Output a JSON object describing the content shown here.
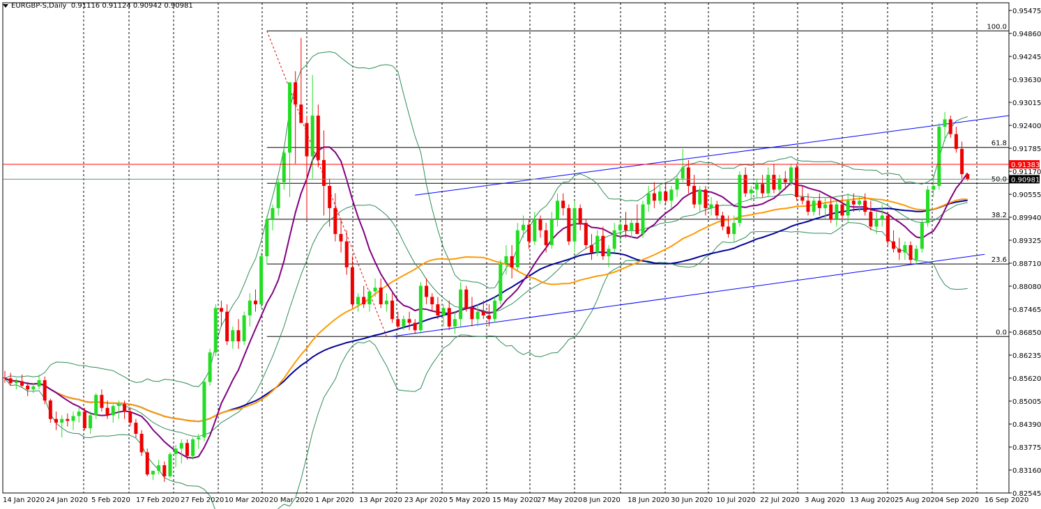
{
  "header": {
    "symbol": "EURGBP-S,Daily",
    "ohlc": "0.91116 0.91124 0.90942 0.90981"
  },
  "price_axis": {
    "ticks": [
      "0.95475",
      "0.94860",
      "0.94245",
      "0.93630",
      "0.93015",
      "0.92400",
      "0.91785",
      "0.91170",
      "0.90555",
      "0.89940",
      "0.89325",
      "0.88710",
      "0.88080",
      "0.87465",
      "0.86850",
      "0.86235",
      "0.85620",
      "0.85005",
      "0.84390",
      "0.83775",
      "0.83160",
      "0.82545"
    ],
    "current_price_label": "0.90981",
    "red_line_label": "0.91383"
  },
  "date_axis": {
    "labels": [
      "14 Jan 2020",
      "24 Jan 2020",
      "5 Feb 2020",
      "17 Feb 2020",
      "27 Feb 2020",
      "10 Mar 2020",
      "20 Mar 2020",
      "1 Apr 2020",
      "13 Apr 2020",
      "23 Apr 2020",
      "5 May 2020",
      "15 May 2020",
      "27 May 2020",
      "8 Jun 2020",
      "18 Jun 2020",
      "30 Jun 2020",
      "10 Jul 2020",
      "22 Jul 2020",
      "3 Aug 2020",
      "13 Aug 2020",
      "25 Aug 2020",
      "4 Sep 2020",
      "16 Sep 2020"
    ]
  },
  "fib_levels": [
    {
      "label": "100.0",
      "value": 0.9499
    },
    {
      "label": "61.8",
      "value": 0.9184
    },
    {
      "label": "50.0",
      "value": 0.9087
    },
    {
      "label": "38.2",
      "value": 0.899
    },
    {
      "label": "23.6",
      "value": 0.8869
    },
    {
      "label": "0.0",
      "value": 0.8673
    }
  ],
  "colors": {
    "bull": "#22dd22",
    "bear": "#ee0000",
    "ma_fast": "#800080",
    "ma_mid": "#ff9900",
    "ma_slow": "#000099",
    "bands": "#2e8b57",
    "trend": "#0000ff",
    "red_line": "#ff0000",
    "grey_line": "#6b8e6b"
  },
  "chart_data": {
    "type": "candlestick",
    "symbol": "EURGBP-S",
    "timeframe": "Daily",
    "ylim": [
      0.825,
      0.9575
    ],
    "candles": [
      [
        0.8562,
        0.858,
        0.8548,
        0.856
      ],
      [
        0.856,
        0.8575,
        0.854,
        0.8547
      ],
      [
        0.8547,
        0.856,
        0.853,
        0.8552
      ],
      [
        0.8552,
        0.857,
        0.8535,
        0.854
      ],
      [
        0.854,
        0.855,
        0.8512,
        0.853
      ],
      [
        0.853,
        0.8545,
        0.852,
        0.8538
      ],
      [
        0.8538,
        0.857,
        0.853,
        0.8555
      ],
      [
        0.8555,
        0.8565,
        0.849,
        0.85
      ],
      [
        0.85,
        0.8505,
        0.844,
        0.845
      ],
      [
        0.845,
        0.847,
        0.842,
        0.844
      ],
      [
        0.844,
        0.846,
        0.84,
        0.845
      ],
      [
        0.845,
        0.8465,
        0.843,
        0.8445
      ],
      [
        0.8445,
        0.847,
        0.842,
        0.8458
      ],
      [
        0.8458,
        0.848,
        0.844,
        0.847
      ],
      [
        0.847,
        0.848,
        0.842,
        0.8425
      ],
      [
        0.8425,
        0.847,
        0.841,
        0.846
      ],
      [
        0.846,
        0.852,
        0.845,
        0.8515
      ],
      [
        0.8515,
        0.853,
        0.847,
        0.848
      ],
      [
        0.848,
        0.85,
        0.845,
        0.846
      ],
      [
        0.846,
        0.849,
        0.844,
        0.8485
      ],
      [
        0.8485,
        0.85,
        0.845,
        0.849
      ],
      [
        0.849,
        0.85,
        0.845,
        0.847
      ],
      [
        0.847,
        0.848,
        0.843,
        0.844
      ],
      [
        0.844,
        0.845,
        0.84,
        0.841
      ],
      [
        0.841,
        0.842,
        0.835,
        0.836
      ],
      [
        0.836,
        0.837,
        0.8295,
        0.83
      ],
      [
        0.83,
        0.831,
        0.8285,
        0.831
      ],
      [
        0.831,
        0.834,
        0.83,
        0.8325
      ],
      [
        0.8325,
        0.8335,
        0.828,
        0.8295
      ],
      [
        0.8295,
        0.836,
        0.829,
        0.8355
      ],
      [
        0.8355,
        0.838,
        0.832,
        0.837
      ],
      [
        0.837,
        0.8395,
        0.833,
        0.8385
      ],
      [
        0.8385,
        0.8395,
        0.834,
        0.835
      ],
      [
        0.835,
        0.84,
        0.834,
        0.8395
      ],
      [
        0.8395,
        0.841,
        0.837,
        0.84
      ],
      [
        0.84,
        0.856,
        0.839,
        0.855
      ],
      [
        0.855,
        0.864,
        0.854,
        0.863
      ],
      [
        0.863,
        0.876,
        0.862,
        0.875
      ],
      [
        0.875,
        0.877,
        0.87,
        0.874
      ],
      [
        0.874,
        0.876,
        0.865,
        0.866
      ],
      [
        0.866,
        0.87,
        0.864,
        0.869
      ],
      [
        0.869,
        0.872,
        0.864,
        0.866
      ],
      [
        0.866,
        0.874,
        0.865,
        0.873
      ],
      [
        0.873,
        0.879,
        0.87,
        0.877
      ],
      [
        0.877,
        0.88,
        0.874,
        0.876
      ],
      [
        0.876,
        0.89,
        0.875,
        0.889
      ],
      [
        0.889,
        0.9,
        0.887,
        0.899
      ],
      [
        0.899,
        0.903,
        0.896,
        0.902
      ],
      [
        0.902,
        0.91,
        0.9,
        0.909
      ],
      [
        0.909,
        0.918,
        0.907,
        0.917
      ],
      [
        0.917,
        0.93,
        0.905,
        0.936
      ],
      [
        0.936,
        0.939,
        0.914,
        0.93
      ],
      [
        0.93,
        0.948,
        0.928,
        0.925
      ],
      [
        0.925,
        0.927,
        0.899,
        0.916
      ],
      [
        0.916,
        0.938,
        0.91,
        0.927
      ],
      [
        0.927,
        0.93,
        0.913,
        0.915
      ],
      [
        0.915,
        0.923,
        0.9,
        0.908
      ],
      [
        0.908,
        0.91,
        0.897,
        0.902
      ],
      [
        0.902,
        0.906,
        0.893,
        0.895
      ],
      [
        0.895,
        0.899,
        0.89,
        0.893
      ],
      [
        0.893,
        0.896,
        0.884,
        0.886
      ],
      [
        0.886,
        0.889,
        0.875,
        0.876
      ],
      [
        0.876,
        0.879,
        0.874,
        0.878
      ],
      [
        0.878,
        0.881,
        0.875,
        0.876
      ],
      [
        0.876,
        0.88,
        0.874,
        0.8795
      ],
      [
        0.8795,
        0.883,
        0.878,
        0.8805
      ],
      [
        0.8805,
        0.883,
        0.875,
        0.876
      ],
      [
        0.876,
        0.879,
        0.874,
        0.877
      ],
      [
        0.877,
        0.879,
        0.871,
        0.872
      ],
      [
        0.872,
        0.874,
        0.869,
        0.87
      ],
      [
        0.87,
        0.873,
        0.869,
        0.872
      ],
      [
        0.872,
        0.874,
        0.869,
        0.871
      ],
      [
        0.871,
        0.872,
        0.868,
        0.869
      ],
      [
        0.869,
        0.882,
        0.868,
        0.881
      ],
      [
        0.881,
        0.883,
        0.876,
        0.878
      ],
      [
        0.878,
        0.879,
        0.874,
        0.876
      ],
      [
        0.876,
        0.878,
        0.872,
        0.873
      ],
      [
        0.873,
        0.876,
        0.87,
        0.875
      ],
      [
        0.875,
        0.877,
        0.869,
        0.87
      ],
      [
        0.87,
        0.874,
        0.868,
        0.872
      ],
      [
        0.872,
        0.882,
        0.87,
        0.88
      ],
      [
        0.88,
        0.881,
        0.874,
        0.875
      ],
      [
        0.875,
        0.878,
        0.87,
        0.872
      ],
      [
        0.872,
        0.876,
        0.87,
        0.874
      ],
      [
        0.874,
        0.877,
        0.872,
        0.873
      ],
      [
        0.873,
        0.876,
        0.87,
        0.872
      ],
      [
        0.872,
        0.878,
        0.871,
        0.877
      ],
      [
        0.877,
        0.888,
        0.876,
        0.887
      ],
      [
        0.887,
        0.892,
        0.884,
        0.889
      ],
      [
        0.889,
        0.892,
        0.883,
        0.886
      ],
      [
        0.886,
        0.898,
        0.885,
        0.896
      ],
      [
        0.896,
        0.9,
        0.894,
        0.8975
      ],
      [
        0.8975,
        0.899,
        0.891,
        0.893
      ],
      [
        0.893,
        0.901,
        0.892,
        0.899
      ],
      [
        0.899,
        0.9,
        0.894,
        0.896
      ],
      [
        0.896,
        0.898,
        0.89,
        0.892
      ],
      [
        0.892,
        0.901,
        0.891,
        0.899
      ],
      [
        0.899,
        0.906,
        0.897,
        0.904
      ],
      [
        0.904,
        0.906,
        0.9,
        0.902
      ],
      [
        0.902,
        0.903,
        0.892,
        0.893
      ],
      [
        0.893,
        0.904,
        0.89,
        0.902
      ],
      [
        0.902,
        0.903,
        0.896,
        0.898
      ],
      [
        0.898,
        0.899,
        0.891,
        0.892
      ],
      [
        0.892,
        0.895,
        0.888,
        0.89
      ],
      [
        0.89,
        0.896,
        0.889,
        0.8945
      ],
      [
        0.8945,
        0.897,
        0.888,
        0.889
      ],
      [
        0.889,
        0.892,
        0.886,
        0.891
      ],
      [
        0.891,
        0.898,
        0.89,
        0.896
      ],
      [
        0.896,
        0.899,
        0.893,
        0.8975
      ],
      [
        0.8975,
        0.901,
        0.894,
        0.896
      ],
      [
        0.896,
        0.899,
        0.894,
        0.898
      ],
      [
        0.898,
        0.903,
        0.895,
        0.895
      ],
      [
        0.895,
        0.904,
        0.894,
        0.903
      ],
      [
        0.903,
        0.908,
        0.901,
        0.906
      ],
      [
        0.906,
        0.909,
        0.902,
        0.904
      ],
      [
        0.904,
        0.908,
        0.903,
        0.9065
      ],
      [
        0.9065,
        0.909,
        0.903,
        0.904
      ],
      [
        0.904,
        0.908,
        0.902,
        0.907
      ],
      [
        0.907,
        0.911,
        0.905,
        0.91
      ],
      [
        0.91,
        0.918,
        0.909,
        0.913
      ],
      [
        0.913,
        0.915,
        0.906,
        0.908
      ],
      [
        0.908,
        0.911,
        0.902,
        0.903
      ],
      [
        0.903,
        0.908,
        0.901,
        0.907
      ],
      [
        0.907,
        0.908,
        0.9,
        0.902
      ],
      [
        0.902,
        0.905,
        0.9,
        0.903
      ],
      [
        0.903,
        0.904,
        0.899,
        0.9
      ],
      [
        0.9,
        0.901,
        0.896,
        0.897
      ],
      [
        0.897,
        0.9,
        0.894,
        0.895
      ],
      [
        0.895,
        0.9,
        0.893,
        0.898
      ],
      [
        0.898,
        0.912,
        0.897,
        0.911
      ],
      [
        0.911,
        0.913,
        0.905,
        0.906
      ],
      [
        0.906,
        0.908,
        0.904,
        0.907
      ],
      [
        0.907,
        0.91,
        0.905,
        0.9085
      ],
      [
        0.9085,
        0.911,
        0.905,
        0.906
      ],
      [
        0.906,
        0.913,
        0.905,
        0.911
      ],
      [
        0.911,
        0.914,
        0.906,
        0.907
      ],
      [
        0.907,
        0.911,
        0.906,
        0.91
      ],
      [
        0.91,
        0.912,
        0.907,
        0.909
      ],
      [
        0.909,
        0.914,
        0.908,
        0.913
      ],
      [
        0.913,
        0.914,
        0.904,
        0.905
      ],
      [
        0.905,
        0.908,
        0.903,
        0.904
      ],
      [
        0.904,
        0.906,
        0.9,
        0.901
      ],
      [
        0.901,
        0.905,
        0.9,
        0.904
      ],
      [
        0.904,
        0.906,
        0.9,
        0.902
      ],
      [
        0.902,
        0.905,
        0.899,
        0.903
      ],
      [
        0.903,
        0.905,
        0.898,
        0.899
      ],
      [
        0.899,
        0.904,
        0.897,
        0.903
      ],
      [
        0.903,
        0.905,
        0.899,
        0.9
      ],
      [
        0.9,
        0.906,
        0.898,
        0.904
      ],
      [
        0.904,
        0.906,
        0.901,
        0.903
      ],
      [
        0.903,
        0.905,
        0.901,
        0.904
      ],
      [
        0.904,
        0.906,
        0.9,
        0.901
      ],
      [
        0.901,
        0.904,
        0.896,
        0.897
      ],
      [
        0.897,
        0.901,
        0.895,
        0.899
      ],
      [
        0.899,
        0.903,
        0.897,
        0.9
      ],
      [
        0.9,
        0.901,
        0.892,
        0.893
      ],
      [
        0.893,
        0.896,
        0.89,
        0.891
      ],
      [
        0.891,
        0.894,
        0.888,
        0.89
      ],
      [
        0.89,
        0.893,
        0.888,
        0.892
      ],
      [
        0.892,
        0.893,
        0.887,
        0.888
      ],
      [
        0.888,
        0.892,
        0.887,
        0.891
      ],
      [
        0.891,
        0.899,
        0.89,
        0.898
      ],
      [
        0.898,
        0.908,
        0.897,
        0.907
      ],
      [
        0.907,
        0.911,
        0.905,
        0.908
      ],
      [
        0.908,
        0.925,
        0.907,
        0.924
      ],
      [
        0.924,
        0.928,
        0.92,
        0.926
      ],
      [
        0.926,
        0.927,
        0.921,
        0.922
      ],
      [
        0.922,
        0.924,
        0.917,
        0.918
      ],
      [
        0.918,
        0.92,
        0.91,
        0.9112
      ],
      [
        0.9112,
        0.9112,
        0.9094,
        0.9098
      ]
    ],
    "fib_retracement": {
      "high": 0.9499,
      "low": 0.8673
    },
    "series": []
  }
}
